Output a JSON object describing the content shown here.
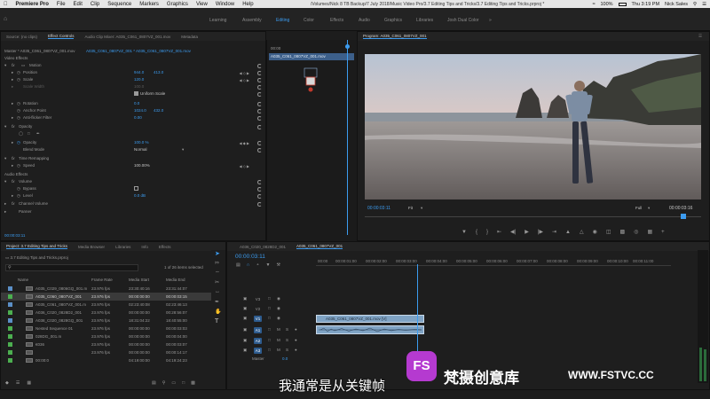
{
  "menubar": {
    "items": [
      "Premiere Pro",
      "File",
      "Edit",
      "Clip",
      "Sequence",
      "Markers",
      "Graphics",
      "View",
      "Window",
      "Help"
    ],
    "path": "/Volumes/Nick 8 TB Backup/7 July 2018/Music Video Pro/3.7 Editing Tips and Tricks/3.7 Editing Tips and Tricks.prproj *",
    "battery": "100%",
    "clock": "Thu 3:19 PM",
    "user": "Nick Sales"
  },
  "workspaces": {
    "items": [
      "Learning",
      "Assembly",
      "Editing",
      "Color",
      "Effects",
      "Audio",
      "Graphics",
      "Libraries",
      "Josh Dual Color"
    ],
    "active": "Editing"
  },
  "effect_controls": {
    "tabs": [
      "Source: (no clips)",
      "Effect Controls",
      "Audio Clip Mixer: A035_C061_0807VZ_001.mov",
      "Metadata"
    ],
    "master_label": "Master * A035_C061_0807VZ_001.mov",
    "clip_label": "A035_C061_0807VZ_001 * A035_C061_0807VZ_001.mov",
    "video_effects": "Video Effects",
    "motion": "Motion",
    "position_label": "Position",
    "position_x": "944.0",
    "position_y": "413.0",
    "scale_label": "Scale",
    "scale_val": "120.0",
    "scale_width_label": "Scale Width",
    "scale_width_val": "100.0",
    "uniform_scale": "Uniform Scale",
    "rotation_label": "Rotation",
    "rotation_val": "0.0",
    "anchor_label": "Anchor Point",
    "anchor_x": "1024.0",
    "anchor_y": "432.0",
    "antiflicker_label": "Anti-flicker Filter",
    "antiflicker_val": "0.00",
    "opacity": "Opacity",
    "opacity_label": "Opacity",
    "opacity_val": "100.0 %",
    "blend_label": "Blend Mode",
    "blend_val": "Normal",
    "time_remap": "Time Remapping",
    "speed_label": "Speed",
    "speed_val": "100.00%",
    "audio_effects": "Audio Effects",
    "volume": "Volume",
    "bypass_label": "Bypass",
    "level_label": "Level",
    "level_val": "0.0 dB",
    "channel_volume": "Channel Volume",
    "panner": "Panner",
    "timecode": "00:00:03:11",
    "mini_timeline_time": "00:00",
    "mini_clip": "A035_C061_0807VZ_001.mov"
  },
  "program_monitor": {
    "title": "Program: A035_C061_0807VZ_001",
    "timecode": "00:00:03:11",
    "fit": "Fit",
    "quality": "Full",
    "duration": "00:00:03:16"
  },
  "project": {
    "tabs": [
      "Project: 3.7 Editing Tips and Tricks",
      "Media Browser",
      "Libraries",
      "Info",
      "Effects"
    ],
    "path": "3.7 Editing Tips and Tricks.prproj",
    "selected_count": "1 of 26 items selected",
    "columns": [
      "Name",
      "Frame Rate",
      "Media Start",
      "Media End"
    ],
    "rows": [
      {
        "name": "A035_C029_0806GQ_001.m",
        "fps": "23.976 fps",
        "start": "23:30:40:16",
        "end": "23:31:44:07",
        "color": "#5b8fc7",
        "sel": false
      },
      {
        "name": "A035_C060_0807VZ_001",
        "fps": "23.976 fps",
        "start": "00:00:00:00",
        "end": "00:00:03:15",
        "color": "#4caf50",
        "sel": true
      },
      {
        "name": "A035_C061_0807VZ_001.m",
        "fps": "23.976 fps",
        "start": "02:23:40:08",
        "end": "02:23:46:13",
        "color": "#5b8fc7",
        "sel": false
      },
      {
        "name": "A036_C020_0828D2_001",
        "fps": "23.976 fps",
        "start": "00:00:00:00",
        "end": "00:28:56:07",
        "color": "#4caf50",
        "sel": false
      },
      {
        "name": "A038_C020_0828GQ_001",
        "fps": "23.976 fps",
        "start": "18:31:04:22",
        "end": "18:40:55:00",
        "color": "#5b8fc7",
        "sel": false
      },
      {
        "name": "Nested Sequence 01",
        "fps": "23.976 fps",
        "start": "00:00:00:00",
        "end": "00:00:03:03",
        "color": "#4caf50",
        "sel": false
      },
      {
        "name": "028DG_001.m",
        "fps": "23.976 fps",
        "start": "00:00:00:00",
        "end": "00:00:04:00",
        "color": "#4caf50",
        "sel": false
      },
      {
        "name": "€036",
        "fps": "23.976 fps",
        "start": "00:00:00:00",
        "end": "00:00:03:07",
        "color": "#4caf50",
        "sel": false
      },
      {
        "name": "",
        "fps": "23.976 fps",
        "start": "00:00:00:00",
        "end": "00:00:14:17",
        "color": "#4caf50",
        "sel": false
      },
      {
        "name": "00:00:0",
        "fps": "",
        "start": "04:19:00:00",
        "end": "04:19:24:23",
        "color": "#4caf50",
        "sel": false
      }
    ]
  },
  "timeline": {
    "tabs": [
      "A036_C020_0828D2_001",
      "A035_C061_0807VZ_001"
    ],
    "timecode": "00:00:03:11",
    "ruler": [
      "00:00",
      "00:00:01:00",
      "00:00:02:00",
      "00:00:03:00",
      "00:00:04:00",
      "00:00:05:00",
      "00:00:06:00",
      "00:00:07:00",
      "00:00:08:00",
      "00:00:09:00",
      "00:00:10:00",
      "00:00:11:00"
    ],
    "tracks": [
      "V3",
      "V2",
      "V1",
      "A1",
      "A2",
      "A3"
    ],
    "master": "Master",
    "master_val": "0.0",
    "clip_v1": "A035_C061_0807VZ_001.mov [V]"
  },
  "subtitle": "我通常是从关键帧",
  "watermark": {
    "brand": "梵摄创意库",
    "url": "WWW.FSTVC.CC"
  },
  "colors": {
    "accent": "#3c9cf0",
    "clip_video": "#7fa3c4",
    "label_green": "#4caf50",
    "label_blue": "#5b8fc7"
  }
}
